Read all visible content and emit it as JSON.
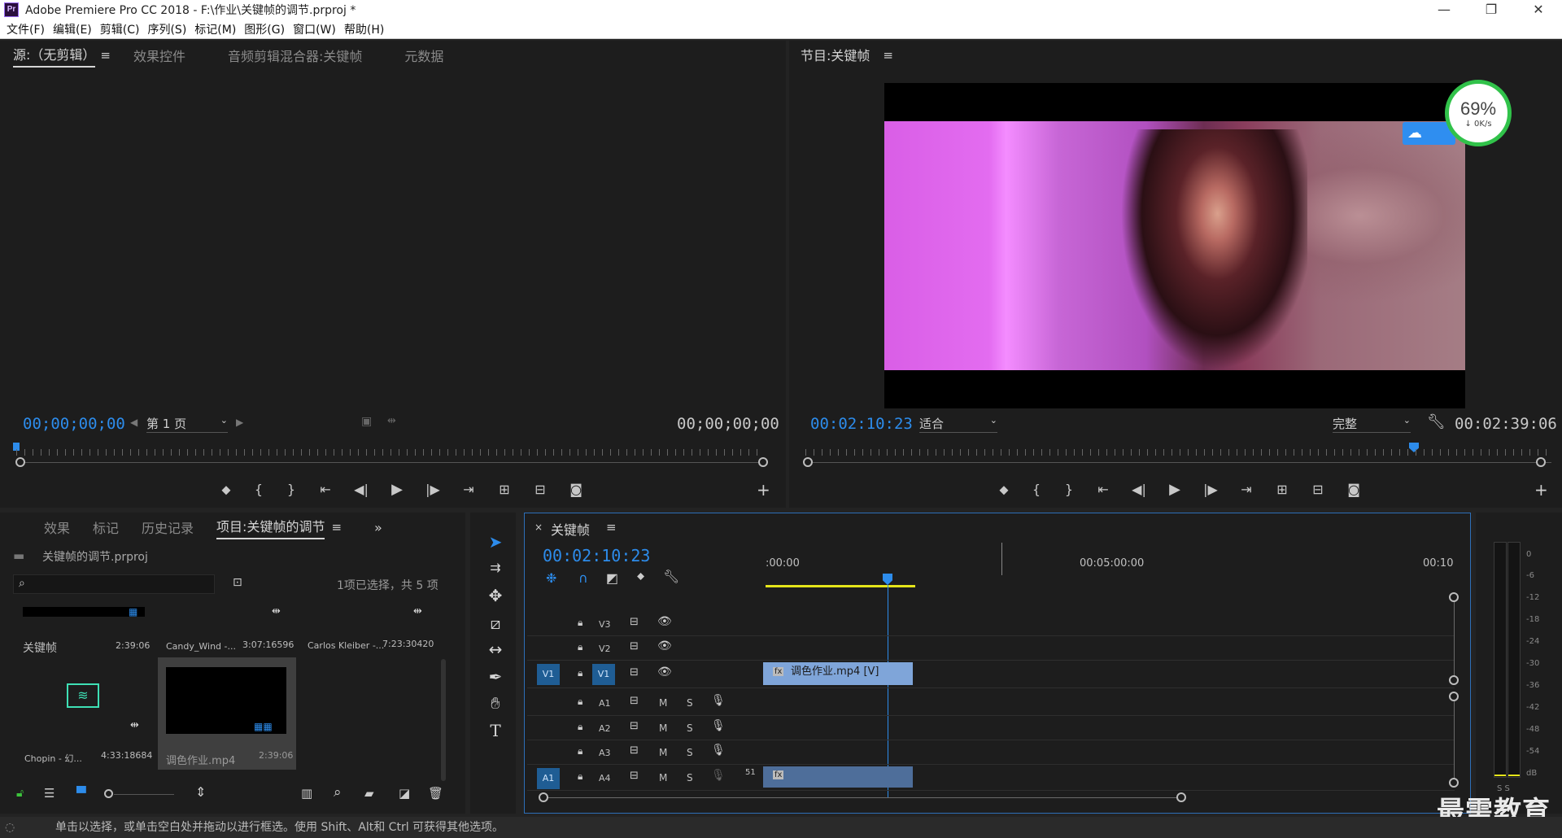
{
  "window": {
    "title": "Adobe Premiere Pro CC 2018 - F:\\作业\\关键帧的调节.prproj *",
    "logo": "Pr",
    "controls": [
      "—",
      "❐",
      "✕"
    ]
  },
  "menu": [
    "文件(F)",
    "编辑(E)",
    "剪辑(C)",
    "序列(S)",
    "标记(M)",
    "图形(G)",
    "窗口(W)",
    "帮助(H)"
  ],
  "source": {
    "tabs": [
      "源:（无剪辑）",
      "效果控件",
      "音频剪辑混合器:关键帧",
      "元数据"
    ],
    "tc_left": "00;00;00;00",
    "tc_right": "00;00;00;00",
    "page": "第 1 页"
  },
  "program": {
    "title": "节目:关键帧",
    "tc_left": "00:02:10:23",
    "tc_right": "00:02:39:06",
    "zoom": "适合",
    "quality": "完整"
  },
  "netmeter": {
    "percent": "69%",
    "speed": "↓ 0K/s",
    "accent": "#31c24a"
  },
  "project": {
    "tabs": [
      "效果",
      "标记",
      "历史记录",
      "项目:关键帧的调节"
    ],
    "file": "关键帧的调节.prproj",
    "selection": "1项已选择，共 5 项",
    "search_placeholder": "",
    "items": [
      {
        "name": "关键帧",
        "duration": "2:39:06"
      },
      {
        "name": "Candy_Wind -...",
        "duration": "3:07:16596"
      },
      {
        "name": "Carlos Kleiber -...",
        "duration": "7:23:30420"
      },
      {
        "name": "Chopin - 幻...",
        "duration": "4:33:18684"
      },
      {
        "name": "调色作业.mp4",
        "duration": "2:39:06"
      }
    ]
  },
  "timeline": {
    "title": "关键帧",
    "tc": "00:02:10:23",
    "ruler": [
      ":00:00",
      "00:05:00:00",
      "00:10"
    ],
    "tracks": [
      {
        "label": "V3",
        "type": "video"
      },
      {
        "label": "V2",
        "type": "video"
      },
      {
        "label": "V1",
        "type": "video",
        "src": "V1"
      },
      {
        "label": "A1",
        "type": "audio"
      },
      {
        "label": "A2",
        "type": "audio"
      },
      {
        "label": "A3",
        "type": "audio"
      },
      {
        "label": "A4",
        "type": "audio",
        "src": "A1"
      }
    ],
    "mute": "M",
    "solo": "S",
    "clip_v1": "调色作业.mp4 [V]",
    "channels": "51",
    "playhead_color": "#2d8ceb",
    "workarea_color": "#e5e51a",
    "clip_color": "#7fa5d9"
  },
  "meter": {
    "scale": [
      "0",
      "-6",
      "-12",
      "-18",
      "-24",
      "-30",
      "-36",
      "-42",
      "-48",
      "-54",
      "dB"
    ],
    "solo": "S S"
  },
  "status": "单击以选择，或单击空白处并拖动以进行框选。使用 Shift、Alt和 Ctrl 可获得其他选项。",
  "watermark": "最需教育"
}
